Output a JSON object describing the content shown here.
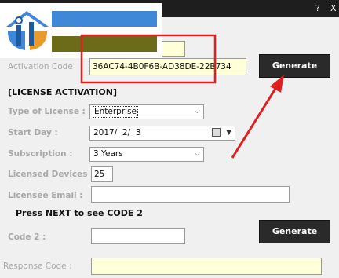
{
  "window": {
    "help_label": "?",
    "close_label": "X"
  },
  "activation": {
    "label": "Activation Code",
    "code": "36AC74-4B0F6B-AD38DE-22B734",
    "generate_label": "Generate"
  },
  "license": {
    "section_title": "[LICENSE ACTIVATION]",
    "type_label": "Type of License :",
    "type_value": "Enterprise",
    "start_day_label": "Start Day :",
    "start_day_value": "2017/  2/  3",
    "subscription_label": "Subscription :",
    "subscription_value": "3 Years",
    "devices_label": "Licensed Devices :",
    "devices_value": "25",
    "email_label": "Licensee Email :",
    "email_value": ""
  },
  "code2": {
    "note": "Press NEXT to see CODE 2",
    "label": "Code 2 :",
    "value": "",
    "generate_label": "Generate"
  },
  "response": {
    "label": "Response Code :",
    "value": ""
  },
  "colors": {
    "highlight_red": "#e02020",
    "button_dark": "#2a2a2a",
    "logo_blue": "#3f88d8",
    "logo_olive": "#6b6b1a"
  }
}
